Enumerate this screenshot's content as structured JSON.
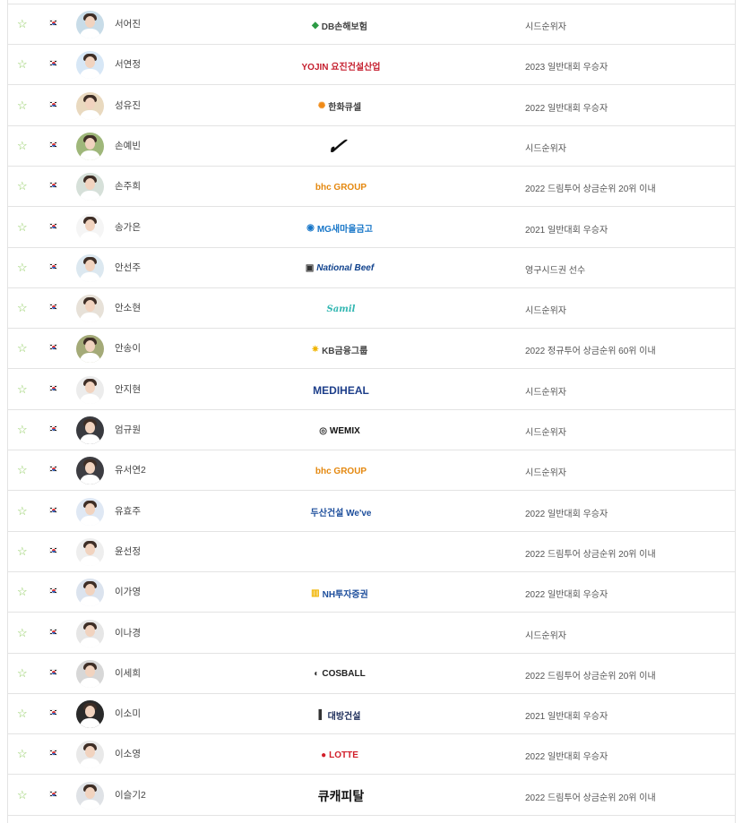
{
  "players": [
    {
      "name": "서어진",
      "sponsor": "DB손해보험",
      "sponsor_icon": "db-logo-icon",
      "note": "시드순위자",
      "avatar_color": "#c8dce8"
    },
    {
      "name": "서연정",
      "sponsor": "YOJIN 요진건설산업",
      "sponsor_icon": "yojin-logo-icon",
      "note": "2023 일반대회 우승자",
      "avatar_color": "#d7e7f6"
    },
    {
      "name": "성유진",
      "sponsor": "한화큐셀",
      "sponsor_icon": "hanwha-logo-icon",
      "note": "2022 일반대회 우승자",
      "avatar_color": "#e9d9bf"
    },
    {
      "name": "손예빈",
      "sponsor": "",
      "sponsor_icon": "nike-swoosh-icon",
      "note": "시드순위자",
      "avatar_color": "#9fb77a"
    },
    {
      "name": "손주희",
      "sponsor": "bhc GROUP",
      "sponsor_icon": "bhc-logo-icon",
      "note": "2022 드림투어 상금순위 20위 이내",
      "avatar_color": "#d6e0d9"
    },
    {
      "name": "송가은",
      "sponsor": "MG새마을금고",
      "sponsor_icon": "mg-logo-icon",
      "note": "2021 일반대회 우승자",
      "avatar_color": "#f5f5f5"
    },
    {
      "name": "안선주",
      "sponsor": "National Beef",
      "sponsor_icon": "national-beef-logo-icon",
      "note": "영구시드권 선수",
      "avatar_color": "#dce8f0"
    },
    {
      "name": "안소현",
      "sponsor": "Samil",
      "sponsor_icon": "samil-logo-icon",
      "note": "시드순위자",
      "avatar_color": "#e7e1d8"
    },
    {
      "name": "안송이",
      "sponsor": "KB금융그룹",
      "sponsor_icon": "kb-logo-icon",
      "note": "2022 정규투어 상금순위 60위 이내",
      "avatar_color": "#a4aa78"
    },
    {
      "name": "안지현",
      "sponsor": "MEDIHEAL",
      "sponsor_icon": "mediheal-logo-icon",
      "note": "시드순위자",
      "avatar_color": "#ececec"
    },
    {
      "name": "엄규원",
      "sponsor": "WEMIX",
      "sponsor_icon": "wemix-logo-icon",
      "note": "시드순위자",
      "avatar_color": "#393a3f"
    },
    {
      "name": "유서연2",
      "sponsor": "bhc GROUP",
      "sponsor_icon": "bhc-logo-icon",
      "note": "시드순위자",
      "avatar_color": "#3d3d42"
    },
    {
      "name": "유효주",
      "sponsor": "두산건설 We've",
      "sponsor_icon": "doosan-logo-icon",
      "note": "2022 일반대회 우승자",
      "avatar_color": "#dfe8f4"
    },
    {
      "name": "윤선정",
      "sponsor": "",
      "sponsor_icon": "",
      "note": "2022 드림투어 상금순위 20위 이내",
      "avatar_color": "#eeeeee"
    },
    {
      "name": "이가영",
      "sponsor": "NH투자증권",
      "sponsor_icon": "nh-logo-icon",
      "note": "2022 일반대회 우승자",
      "avatar_color": "#dbe3ee"
    },
    {
      "name": "이나경",
      "sponsor": "",
      "sponsor_icon": "",
      "note": "시드순위자",
      "avatar_color": "#e6e6e6"
    },
    {
      "name": "이세희",
      "sponsor": "COSBALL",
      "sponsor_icon": "cosball-logo-icon",
      "note": "2022 드림투어 상금순위 20위 이내",
      "avatar_color": "#d7d7d7"
    },
    {
      "name": "이소미",
      "sponsor": "대방건설",
      "sponsor_icon": "daebang-logo-icon",
      "note": "2021 일반대회 우승자",
      "avatar_color": "#2a2a2a"
    },
    {
      "name": "이소영",
      "sponsor": "LOTTE",
      "sponsor_icon": "lotte-logo-icon",
      "note": "2022 일반대회 우승자",
      "avatar_color": "#e9e9e9"
    },
    {
      "name": "이슬기2",
      "sponsor": "큐캐피탈",
      "sponsor_icon": "q-capital-logo-icon",
      "note": "2022 드림투어 상금순위 20위 이내",
      "avatar_color": "#dfe2e6"
    }
  ]
}
